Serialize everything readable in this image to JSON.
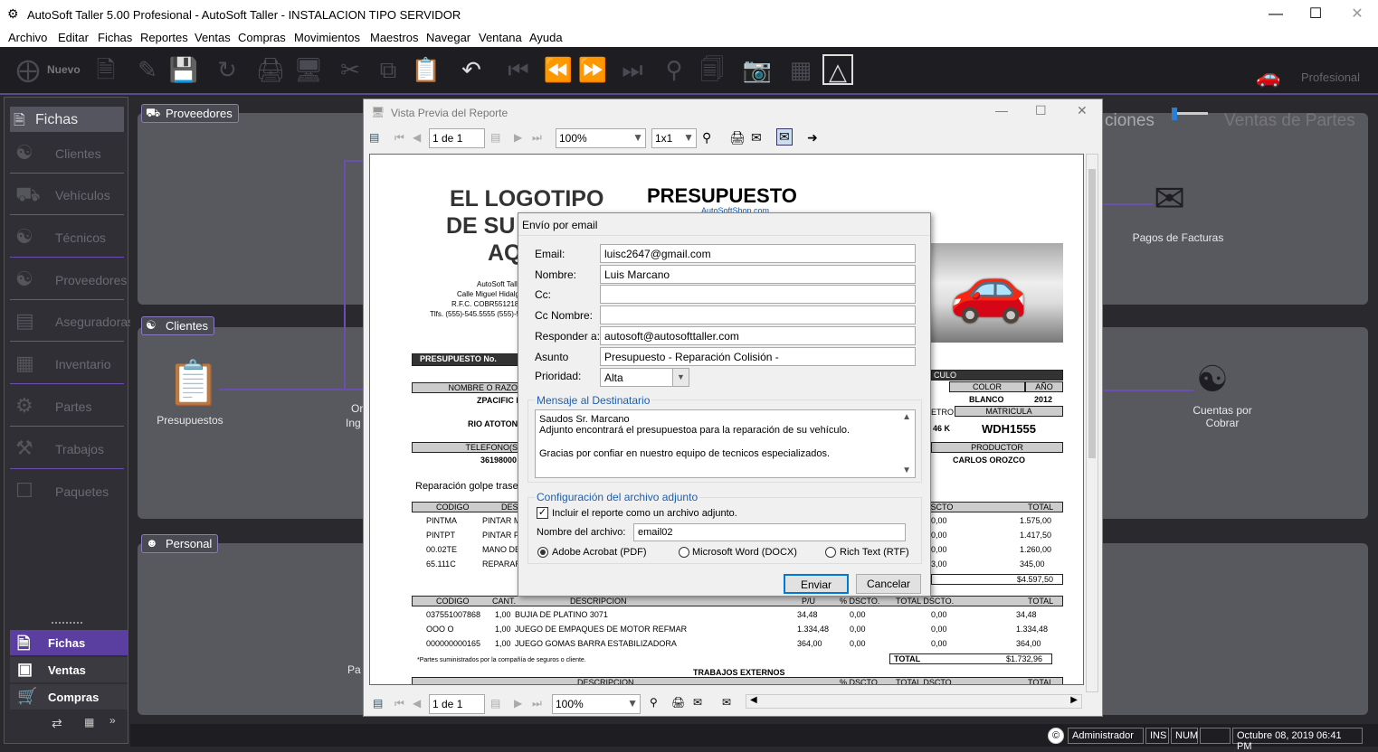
{
  "window": {
    "title": "AutoSoft Taller 5.00 Profesional - AutoSoft Taller - INSTALACION TIPO SERVIDOR"
  },
  "menu": [
    "Archivo",
    "Editar",
    "Fichas",
    "Reportes",
    "Ventas",
    "Compras",
    "Movimientos",
    "Maestros",
    "Navegar",
    "Ventana",
    "Ayuda"
  ],
  "toolbar": {
    "new_label": "Nuevo",
    "edition": "Profesional"
  },
  "sidebar": {
    "header": "Fichas",
    "items": [
      "Clientes",
      "Vehículos",
      "Técnicos",
      "Proveedores",
      "Aseguradoras",
      "Inventario",
      "Partes",
      "Trabajos",
      "Paquetes"
    ],
    "tabs": [
      "Fichas",
      "Ventas",
      "Compras"
    ]
  },
  "main": {
    "proveedores": "Proveedores",
    "clientes": "Clientes",
    "personal": "Personal",
    "presupuestos": "Presupuestos",
    "pagos_facturas": "Pagos de Facturas",
    "cuentas_cobrar": "Cuentas por Cobrar",
    "tab_partial": "ciones",
    "ventas_partes": "Ventas de Partes",
    "ori_partial": "Or",
    "ing_partial": "Ing",
    "pa_partial": "Pa"
  },
  "report": {
    "title": "Vista Previa del Reporte",
    "page_indicator": "1 de 1",
    "zoom": "100%",
    "layout": "1x1",
    "doc": {
      "logo_line1": "EL LOGOTIPO",
      "logo_line2": "DE SU",
      "logo_line3": "AQ",
      "heading": "PRESUPUESTO",
      "site": "AutoSoftShop.com",
      "addr1": "AutoSoft Talle",
      "addr2": "Calle Miguel Hidalg",
      "addr3": "R.F.C. COBR551218",
      "addr4": "Tlfs. (555)-545.5555  (555)-5",
      "presupuesto_no": "PRESUPUESTO No.",
      "nombre_razon": "NOMBRE O RAZO",
      "cliente": "ZPACIFIC NW",
      "ciudad": "RIO ATOTON",
      "telefono_lbl": "TELEFONO(S",
      "telefono": "36198000",
      "vehiculo_lbl": "CULO",
      "color_lbl": "COLOR",
      "anio_lbl": "AÑO",
      "color": "BLANCO",
      "anio": "2012",
      "metro_lbl": "ETRO",
      "matricula_lbl": "MATRICULA",
      "km": "46 K",
      "matricula": "WDH1555",
      "productor_lbl": "PRODUCTOR",
      "productor": "CARLOS OROZCO",
      "reparacion": "Reparación golpe trase",
      "codigo_lbl": "CODIGO",
      "des_lbl": "DES",
      "dscto_lbl": "DSCTO",
      "total_lbl": "TOTAL",
      "rows1": [
        {
          "code": "PINTMA",
          "desc": "PINTAR M",
          "dscto": "0,00",
          "total": "1.575,00"
        },
        {
          "code": "PINTPT",
          "desc": "PINTAR P",
          "dscto": "0,00",
          "total": "1.417,50"
        },
        {
          "code": "00.02TE",
          "desc": "MANO DE",
          "dscto": "0,00",
          "total": "1.260,00"
        },
        {
          "code": "65.111C",
          "desc": "REPARAR",
          "dscto": "3,00",
          "total": "345,00"
        }
      ],
      "subtotal1": "$4.597,50",
      "cant_lbl": "CANT.",
      "descripcion_lbl": "DESCRIPCION",
      "pu_lbl": "P/U",
      "pdscto_lbl": "% DSCTO.",
      "total_dscto_lbl": "TOTAL DSCTO.",
      "rows2": [
        {
          "code": "037551007868",
          "cant": "1,00",
          "desc": "BUJIA DE PLATINO 3071",
          "pu": "34,48",
          "pd": "0,00",
          "td": "0,00",
          "total": "34,48"
        },
        {
          "code": "OOO O",
          "cant": "1,00",
          "desc": "JUEGO DE EMPAQUES DE MOTOR REFMAR",
          "pu": "1.334,48",
          "pd": "0,00",
          "td": "0,00",
          "total": "1.334,48"
        },
        {
          "code": "000000000165",
          "cant": "1,00",
          "desc": "JUEGO GOMAS BARRA ESTABILIZADORA",
          "pu": "364,00",
          "pd": "0,00",
          "td": "0,00",
          "total": "364,00"
        }
      ],
      "partes_note": "*Partes suministrados por la compañía de seguros o cliente.",
      "total_word": "TOTAL",
      "subtotal2": "$1.732,96",
      "trabajos_externos": "TRABAJOS EXTERNOS"
    }
  },
  "dialog": {
    "title": "Envío por email",
    "email_lbl": "Email:",
    "email": "luisc2647@gmail.com",
    "nombre_lbl": "Nombre:",
    "nombre": "Luis Marcano",
    "cc_lbl": "Cc:",
    "cc": "",
    "cc_nombre_lbl": "Cc Nombre:",
    "cc_nombre": "",
    "responder_lbl": "Responder a:",
    "responder": "autosoft@autosofttaller.com",
    "asunto_lbl": "Asunto",
    "asunto": "Presupuesto - Reparación Colisión -",
    "prioridad_lbl": "Prioridad:",
    "prioridad": "Alta",
    "mensaje_group": "Mensaje al Destinatario",
    "mensaje_l1": "Saudos Sr. Marcano",
    "mensaje_l2": "Adjunto encontrará el presupuestoa para la reparación de su vehículo.",
    "mensaje_l3": "Gracias por confiar en nuestro equipo de tecnicos especializados.",
    "adjunto_group": "Configuración del archivo adjunto",
    "incluir": "Incluir el reporte como un archivo adjunto.",
    "archivo_lbl": "Nombre del archivo:",
    "archivo": "email02",
    "opt_pdf": "Adobe Acrobat (PDF)",
    "opt_word": "Microsoft Word (DOCX)",
    "opt_rtf": "Rich Text (RTF)",
    "enviar": "Enviar",
    "cancelar": "Cancelar"
  },
  "status": {
    "user": "Administrador",
    "ins": "INS",
    "num": "NUM",
    "datetime": "Octubre 08, 2019 06:41 PM"
  }
}
